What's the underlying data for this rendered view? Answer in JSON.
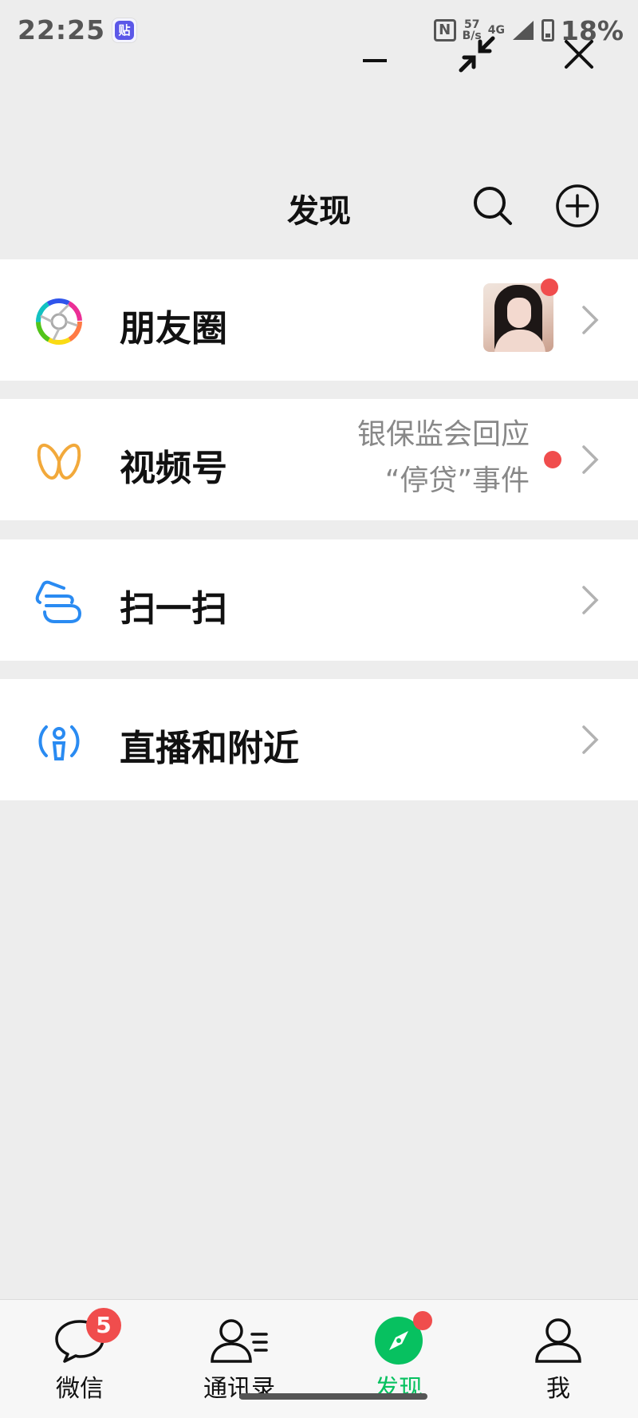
{
  "status_bar": {
    "time": "22:25",
    "app_icon_text": "贴",
    "nfc": "N",
    "speed_value": "57",
    "speed_unit": "B/s",
    "network": "4G",
    "battery_pct": "18%"
  },
  "window_controls": {
    "minimize": "minimize-icon",
    "shrink": "shrink-icon",
    "close": "close-icon"
  },
  "header": {
    "title": "发现",
    "search_icon": "search-icon",
    "add_icon": "plus-circle-icon"
  },
  "menu": [
    {
      "label": "朋友圈",
      "icon": "moments-aperture-icon",
      "has_thumbnail": true,
      "has_dot": true
    },
    {
      "label": "视频号",
      "icon": "channels-butterfly-icon",
      "preview_line1": "银保监会回应",
      "preview_line2": "“停贷”事件",
      "has_dot": true
    },
    {
      "label": "扫一扫",
      "icon": "scan-icon"
    },
    {
      "label": "直播和附近",
      "icon": "live-nearby-icon"
    }
  ],
  "tabbar": {
    "tabs": [
      {
        "label": "微信",
        "icon": "chat-bubble-icon",
        "badge": "5"
      },
      {
        "label": "通讯录",
        "icon": "contacts-icon"
      },
      {
        "label": "发现",
        "icon": "compass-icon",
        "active": true,
        "has_dot": true
      },
      {
        "label": "我",
        "icon": "person-icon"
      }
    ]
  },
  "colors": {
    "accent": "#07c160",
    "badge": "#f04d4d",
    "background": "#ededed"
  }
}
